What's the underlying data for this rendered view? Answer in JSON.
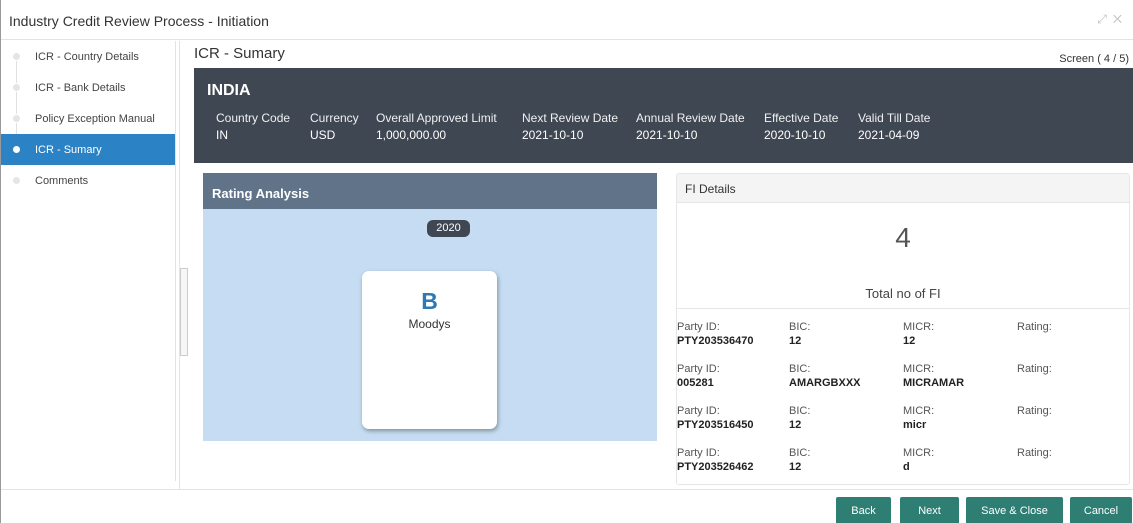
{
  "window": {
    "title": "Industry Credit Review Process - Initiation",
    "controls": "⤢ ✕"
  },
  "sidebar": {
    "items": [
      {
        "label": "ICR - Country Details",
        "active": false
      },
      {
        "label": "ICR - Bank Details",
        "active": false
      },
      {
        "label": "Policy Exception Manual",
        "active": false
      },
      {
        "label": "ICR - Sumary",
        "active": true
      },
      {
        "label": "Comments",
        "active": false
      }
    ]
  },
  "header": {
    "title": "ICR - Sumary",
    "screen": "Screen ( 4 / 5)"
  },
  "banner": {
    "country": "INDIA",
    "fields": [
      {
        "label": "Country Code",
        "value": "IN"
      },
      {
        "label": "Currency",
        "value": "USD"
      },
      {
        "label": "Overall Approved Limit",
        "value": "1,000,000.00"
      },
      {
        "label": "Next Review Date",
        "value": "2021-10-10"
      },
      {
        "label": "Annual Review Date",
        "value": "2021-10-10"
      },
      {
        "label": "Effective Date",
        "value": "2020-10-10"
      },
      {
        "label": "Valid Till Date",
        "value": "2021-04-09"
      }
    ]
  },
  "rating": {
    "title": "Rating Analysis",
    "year": "2020",
    "grade": "B",
    "agency": "Moodys"
  },
  "fi": {
    "title": "FI Details",
    "count": "4",
    "count_label": "Total no of FI",
    "labels": {
      "party": "Party ID:",
      "bic": "BIC:",
      "micr": "MICR:",
      "rating": "Rating:"
    },
    "rows": [
      {
        "party": "PTY203536470",
        "bic": "12",
        "micr": "12",
        "rating": ""
      },
      {
        "party": "005281",
        "bic": "AMARGBXXX",
        "micr": "MICRAMAR",
        "rating": ""
      },
      {
        "party": "PTY203516450",
        "bic": "12",
        "micr": "micr",
        "rating": ""
      },
      {
        "party": "PTY203526462",
        "bic": "12",
        "micr": "d",
        "rating": ""
      }
    ]
  },
  "footer": {
    "back": "Back",
    "next": "Next",
    "save_close": "Save & Close",
    "cancel": "Cancel"
  },
  "colors": {
    "accent": "#2b82c4",
    "banner": "#3f4753",
    "button": "#2e7e74",
    "rating_bg": "#c5dcf2"
  }
}
